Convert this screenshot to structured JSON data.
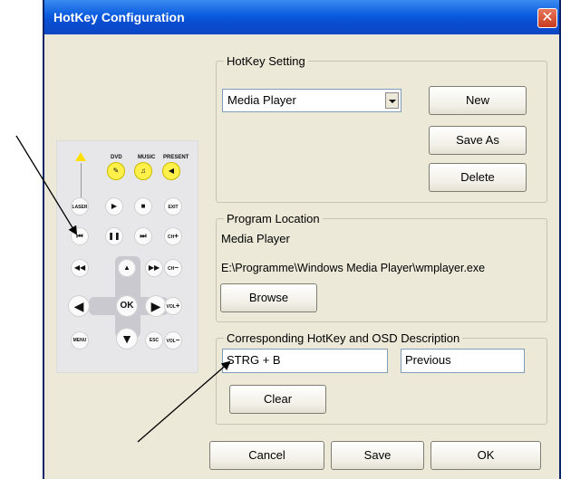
{
  "window": {
    "title": "HotKey Configuration",
    "close_glyph": "✕"
  },
  "remote": {
    "labels": {
      "dvd": "DVD",
      "music": "MUSIC",
      "present": "PRESENT",
      "laser": "LASER",
      "exit": "EXIT",
      "ch_up": "CH",
      "ch_down": "CH",
      "vol_up": "VOL",
      "vol_down": "VOL",
      "ok": "OK",
      "menu": "MENU",
      "esc": "ESC"
    }
  },
  "hotkey_setting": {
    "legend": "HotKey Setting",
    "selected_profile": "Media Player",
    "new_label": "New",
    "save_as_label": "Save As",
    "delete_label": "Delete"
  },
  "program_location": {
    "legend": "Program Location",
    "program_name": "Media Player",
    "program_path": "E:\\Programme\\Windows Media Player\\wmplayer.exe",
    "browse_label": "Browse"
  },
  "hotkey_osd": {
    "legend": "Corresponding HotKey and OSD Description",
    "hotkey_value": "STRG + B",
    "osd_value": "Previous",
    "clear_label": "Clear"
  },
  "footer": {
    "cancel_label": "Cancel",
    "save_label": "Save",
    "ok_label": "OK"
  }
}
